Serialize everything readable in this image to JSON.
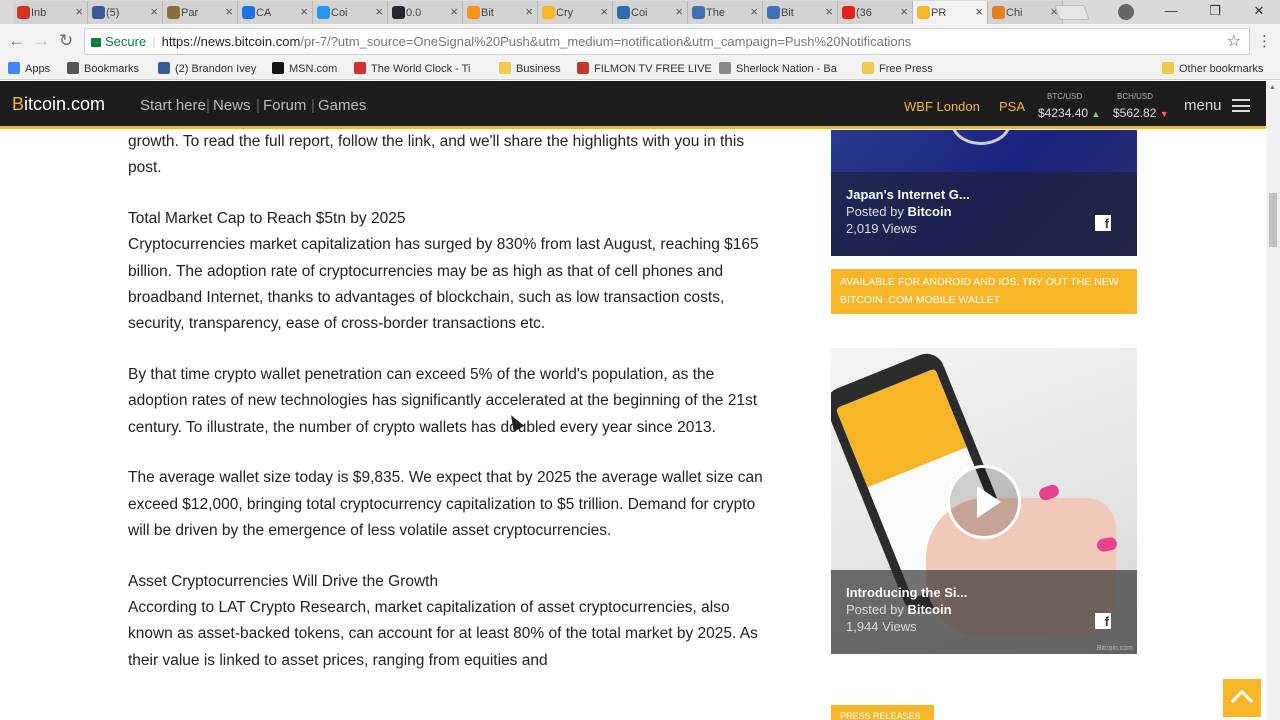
{
  "browser": {
    "tabs": [
      {
        "label": "Inb",
        "icon": "gmail-icon",
        "color": "#d93025"
      },
      {
        "label": "(5)",
        "icon": "facebook-icon",
        "color": "#3b5998"
      },
      {
        "label": "Par",
        "icon": "document-icon",
        "color": "#8a6d3b"
      },
      {
        "label": "CA",
        "icon": "coin-icon",
        "color": "#1a73e8"
      },
      {
        "label": "Coi",
        "icon": "coin-icon",
        "color": "#2196f3"
      },
      {
        "label": "0.0",
        "icon": "ripple-icon",
        "color": "#23292f"
      },
      {
        "label": "Bit",
        "icon": "bitcoin-icon",
        "color": "#f7931a"
      },
      {
        "label": "Cry",
        "icon": "coin-icon",
        "color": "#f7b528"
      },
      {
        "label": "Coi",
        "icon": "coin-icon",
        "color": "#2b6cb0"
      },
      {
        "label": "The",
        "icon": "cp-icon",
        "color": "#3f6fb5"
      },
      {
        "label": "Bit",
        "icon": "cp-icon",
        "color": "#3f6fb5"
      },
      {
        "label": "(36",
        "icon": "youtube-icon",
        "color": "#e62117"
      },
      {
        "label": "PR",
        "icon": "bitcoin-icon",
        "color": "#f7b528",
        "active": true
      },
      {
        "label": "Chi",
        "icon": "coin-icon",
        "color": "#e67e22"
      }
    ],
    "secure_label": "Secure",
    "url_main": "https://news.bitcoin.com",
    "url_rest": "/pr-7/?utm_source=OneSignal%20Push&utm_medium=notification&utm_campaign=Push%20Notifications",
    "bookmarks": [
      {
        "label": "Apps",
        "icon": "apps-icon",
        "color": "#4285f4"
      },
      {
        "label": "Bookmarks",
        "icon": "star-icon",
        "color": "#555555"
      },
      {
        "label": "(2) Brandon Ivey",
        "icon": "facebook-icon",
        "color": "#3b5998"
      },
      {
        "label": "MSN.com",
        "icon": "msn-icon",
        "color": "#111111"
      },
      {
        "label": "The World Clock - Ti",
        "icon": "clock-icon",
        "color": "#cc3333"
      },
      {
        "label": "Business",
        "icon": "folder-icon",
        "color": "#f2c94c"
      },
      {
        "label": "FILMON TV FREE LIVE",
        "icon": "filmon-icon",
        "color": "#c0392b"
      },
      {
        "label": "Sherlock Nation - Ba",
        "icon": "page-icon",
        "color": "#888888"
      },
      {
        "label": "Free Press",
        "icon": "folder-icon",
        "color": "#f2c94c"
      },
      {
        "label": "Other bookmarks",
        "icon": "folder-icon",
        "color": "#f2c94c"
      }
    ]
  },
  "site": {
    "logo_accent": "B",
    "logo_rest": "itcoin.com",
    "menu": [
      "Start here",
      "News",
      "Forum",
      "Games"
    ],
    "wbf": "WBF London",
    "psa": "PSA",
    "btc_label": "BTC/USD",
    "btc_value": "$4234.40",
    "bch_label": "BCH/USD",
    "bch_value": "$562.82",
    "menu_label": "menu",
    "accent_color": "#f7b528"
  },
  "article": {
    "intro": "growth. To read the full report, follow the link, and we'll share the highlights with you in this post.",
    "heading1": "Total Market Cap to Reach $5tn by 2025",
    "p1": "Cryptocurrencies market capitalization has surged by 830% from last August, reaching $165 billion. The adoption rate of cryptocurrencies may be as high as that of cell phones and broadband Internet, thanks to advantages of blockchain, such as low transaction costs, security, transparency, ease of cross-border transactions etc.",
    "p2": "By that time crypto wallet penetration can exceed 5% of the world's population, as the adoption rates of new technologies has significantly accelerated at the beginning of the 21st century. To illustrate, the number of crypto wallets has doubled every year since 2013.",
    "p3": "The average wallet size today is $9,835. We expect that by 2025 the average wallet size can exceed $12,000, bringing total cryptocurrency capitalization to $5 trillion. Demand for crypto will be driven by the emergence of less volatile asset cryptocurrencies.",
    "heading2": "Asset Cryptocurrencies Will Drive the Growth",
    "p4": "According to LAT Crypto Research, market capitalization of asset cryptocurrencies, also known as asset-backed tokens, can account for at least 80% of the total market by 2025. As their value is linked to asset prices, ranging from equities and"
  },
  "sidebar": {
    "card1": {
      "title": "Japan's Internet G...",
      "posted_prefix": "Posted by",
      "author": "Bitcoin",
      "views": "2,019 Views"
    },
    "promo": "AVAILABLE FOR ANDROID AND IOS. TRY OUT THE NEW BITCOIN .COM MOBILE WALLET",
    "card2": {
      "title": "Introducing the Si...",
      "posted_prefix": "Posted by",
      "author": "Bitcoin",
      "views": "1,944 Views",
      "watermark": "Bitcoin.com"
    },
    "press": "PRESS RELEASES"
  }
}
